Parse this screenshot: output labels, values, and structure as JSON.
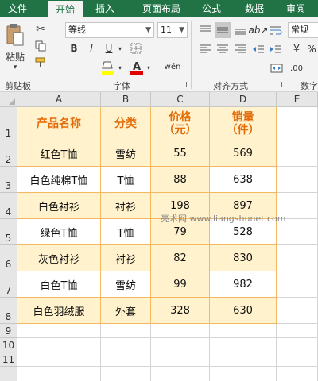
{
  "ribbon": {
    "tabs": [
      {
        "label": "文件",
        "active": false
      },
      {
        "label": "开始",
        "active": true
      },
      {
        "label": "插入",
        "active": false
      },
      {
        "label": "页面布局",
        "active": false
      },
      {
        "label": "公式",
        "active": false
      },
      {
        "label": "数据",
        "active": false
      },
      {
        "label": "审阅",
        "active": false
      }
    ],
    "clipboard": {
      "paste_label": "粘贴",
      "group_label": "剪贴板"
    },
    "font": {
      "font_name": "等线",
      "font_size": "11",
      "bold": "B",
      "italic": "I",
      "underline": "U",
      "pinyin": "wén",
      "group_label": "字体"
    },
    "alignment": {
      "group_label": "对齐方式"
    },
    "number": {
      "format": "常规",
      "group_label": "数字"
    }
  },
  "sheet": {
    "columns": [
      "A",
      "B",
      "C",
      "D",
      "E"
    ],
    "rows": [
      "1",
      "2",
      "3",
      "4",
      "5",
      "6",
      "7",
      "8",
      "9",
      "10",
      "11"
    ],
    "headers": [
      "产品名称",
      "分类",
      "价格\n（元）",
      "销量\n（件）"
    ],
    "data": [
      [
        "红色T恤",
        "雪纺",
        "55",
        "569"
      ],
      [
        "白色纯棉T恤",
        "T恤",
        "88",
        "638"
      ],
      [
        "白色衬衫",
        "衬衫",
        "198",
        "897"
      ],
      [
        "绿色T恤",
        "T恤",
        "79",
        "528"
      ],
      [
        "灰色衬衫",
        "衬衫",
        "82",
        "830"
      ],
      [
        "白色T恤",
        "雪纺",
        "99",
        "982"
      ],
      [
        "白色羽绒服",
        "外套",
        "328",
        "630"
      ]
    ],
    "header_color": "#e36c09",
    "band_color": "#fff2cc",
    "border_color": "#f4b860"
  },
  "watermark": "亮术网 www.liangshunet.com",
  "colors": {
    "excel_green": "#217346",
    "ribbon_bg": "#f3f3f3"
  },
  "icons": [
    "paste-icon",
    "cut-icon",
    "copy-icon",
    "format-painter-icon",
    "fill-color-icon",
    "font-color-icon",
    "border-icon",
    "orientation-icon",
    "wrap-text-icon",
    "merge-center-icon",
    "currency-icon",
    "percent-icon",
    "comma-icon"
  ]
}
